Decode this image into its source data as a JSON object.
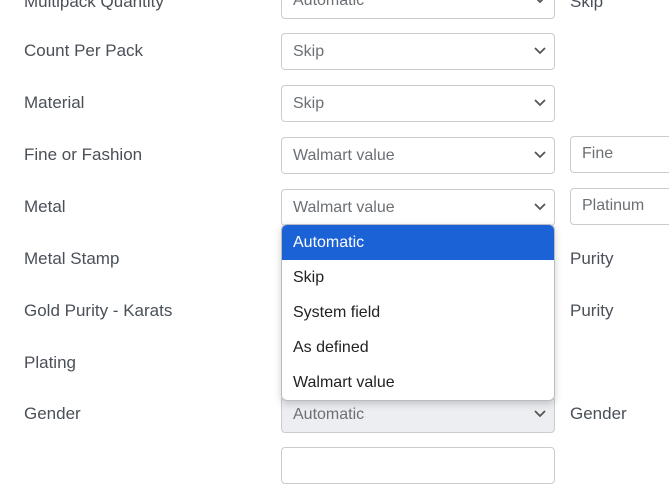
{
  "rows": [
    {
      "label": "Multipack Quantity",
      "select": "Automatic",
      "extra": "Skip"
    },
    {
      "label": "Count Per Pack",
      "select": "Skip"
    },
    {
      "label": "Material",
      "select": "Skip"
    },
    {
      "label": "Fine or Fashion",
      "select": "Walmart value",
      "extra": "Fine"
    },
    {
      "label": "Metal",
      "select": "Walmart value",
      "extra": "Platinum"
    },
    {
      "label": "Metal Stamp",
      "extra": "Purity"
    },
    {
      "label": "Gold Purity - Karats",
      "extra": "Purity"
    },
    {
      "label": "Plating"
    },
    {
      "label": "Gender",
      "select": "Automatic",
      "extra": "Gender"
    }
  ],
  "dropdown": {
    "options": [
      "Automatic",
      "Skip",
      "System field",
      "As defined",
      "Walmart value"
    ],
    "selected": "Automatic"
  }
}
